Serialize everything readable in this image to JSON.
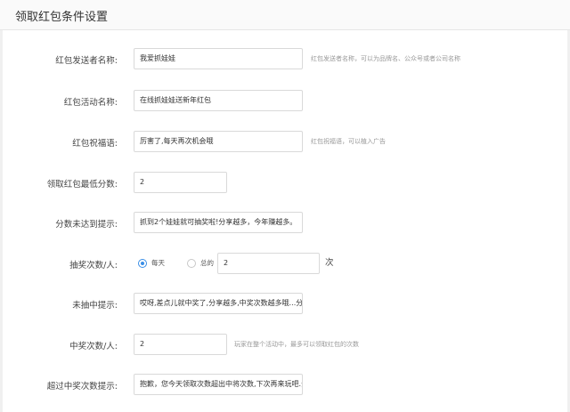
{
  "header": {
    "title": "领取红包条件设置"
  },
  "form": {
    "sender_name": {
      "label": "红包发送者名称:",
      "value": "我爱抓娃娃",
      "hint": "红包发送者名称，可以为品牌名、公众号或者公司名称"
    },
    "activity_name": {
      "label": "红包活动名称:",
      "value": "在线抓娃娃送新年红包"
    },
    "blessing": {
      "label": "红包祝福语:",
      "value": "厉害了,每天再次机会哦",
      "hint": "红包祝福语，可以植入广告"
    },
    "min_score": {
      "label": "领取红包最低分数:",
      "value": "2"
    },
    "score_not_reached": {
      "label": "分数未达到提示:",
      "value": "抓到2个娃娃就可抽奖啦!分享越多，今年赚越多。"
    },
    "draws_per_person": {
      "label": "抽奖次数/人:",
      "option_daily": "每天",
      "option_total": "总的",
      "selected": "每天",
      "value": "2",
      "unit": "次"
    },
    "not_won_tip": {
      "label": "未抽中提示:",
      "value": "哎呀,差点儿就中奖了,分享越多,中奖次数越多哦...分享越多,"
    },
    "wins_per_person": {
      "label": "中奖次数/人:",
      "value": "2",
      "hint": "玩家在整个活动中，最多可以领取红包的次数"
    },
    "exceed_wins_tip": {
      "label": "超过中奖次数提示:",
      "value": "抱歉，您今天领取次数超出中将次数,下次再来玩吧.分享越多"
    }
  },
  "colors": {
    "accent": "#3a8ee6",
    "hint": "#999999",
    "border": "#d9d9d9"
  }
}
